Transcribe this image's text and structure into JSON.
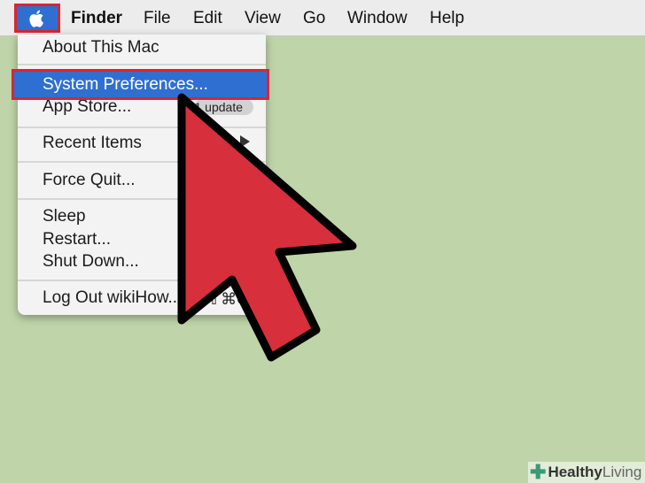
{
  "menubar": {
    "apple_icon": "apple-logo-icon",
    "items": [
      "Finder",
      "File",
      "Edit",
      "View",
      "Go",
      "Window",
      "Help"
    ]
  },
  "apple_menu": {
    "about": "About This Mac",
    "system_preferences": "System Preferences...",
    "app_store": "App Store...",
    "app_store_badge": "1 update",
    "recent_items": "Recent Items",
    "force_quit": "Force Quit...",
    "sleep": "Sleep",
    "restart": "Restart...",
    "shut_down": "Shut Down...",
    "log_out": "Log Out wikiHow...",
    "log_out_shortcut": "⇧⌘Q"
  },
  "watermark": {
    "brand": "Healthy",
    "brand2": "Living"
  },
  "colors": {
    "background": "#bfd5a9",
    "highlight": "#2f6fd1",
    "annotation_red": "#d9262f",
    "cursor_red": "#d82f3c"
  }
}
